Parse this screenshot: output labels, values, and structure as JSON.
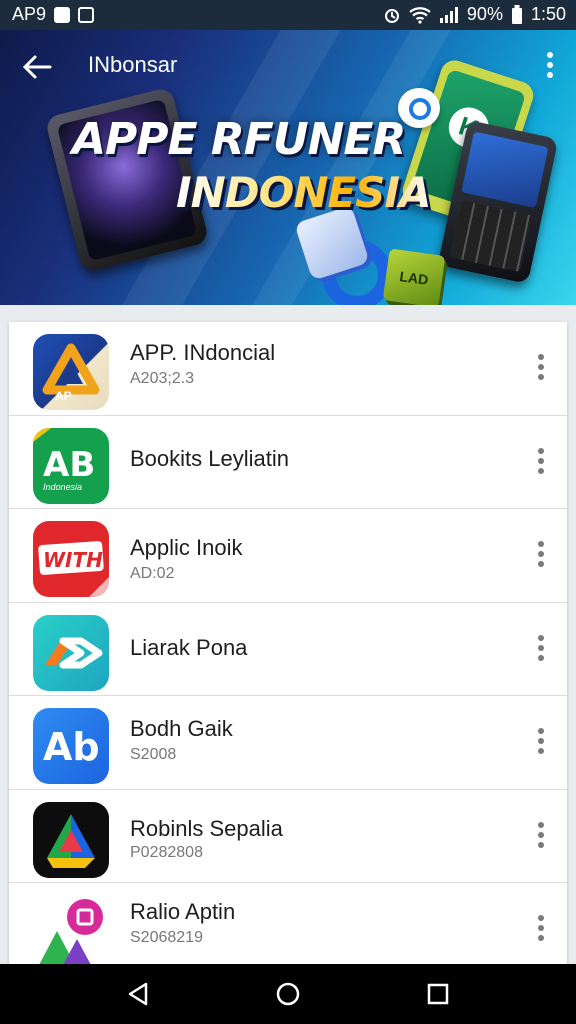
{
  "status_bar": {
    "left_text": "AP9",
    "battery": "90%",
    "time": "1:50"
  },
  "toolbar": {
    "title": "INbonsar"
  },
  "banner": {
    "line1": "APPE RFUNER",
    "line2": "INDONESIA",
    "green_logo": "K",
    "green_cube": "LAD"
  },
  "apps": [
    {
      "name": "APP. INdoncial",
      "sub": "A203;2.3",
      "icon": "ap-triangle-icon",
      "icon_text": "AP"
    },
    {
      "name": "Bookits Leyliatin",
      "sub": "",
      "icon": "ab-green-icon",
      "icon_text": "AB",
      "icon_sub": "Indonesia"
    },
    {
      "name": "Applic Inoik",
      "sub": "AD:02",
      "icon": "red-sticker-icon",
      "icon_text": "WITH"
    },
    {
      "name": "Liarak Pona",
      "sub": "",
      "icon": "teal-arrow-icon"
    },
    {
      "name": "Bodh Gaik",
      "sub": "S2008",
      "icon": "ab-blue-icon",
      "icon_text": "Ab"
    },
    {
      "name": "Robinls Sepalia",
      "sub": "P0282808",
      "icon": "drive-triangle-icon"
    },
    {
      "name": "Ralio Aptin",
      "sub": "S2068219",
      "icon": "pink-badge-icon"
    }
  ],
  "colors": {
    "status_bar": "#1d2c3d",
    "accent": "#1c64e0",
    "list_bg": "#ffffff"
  }
}
